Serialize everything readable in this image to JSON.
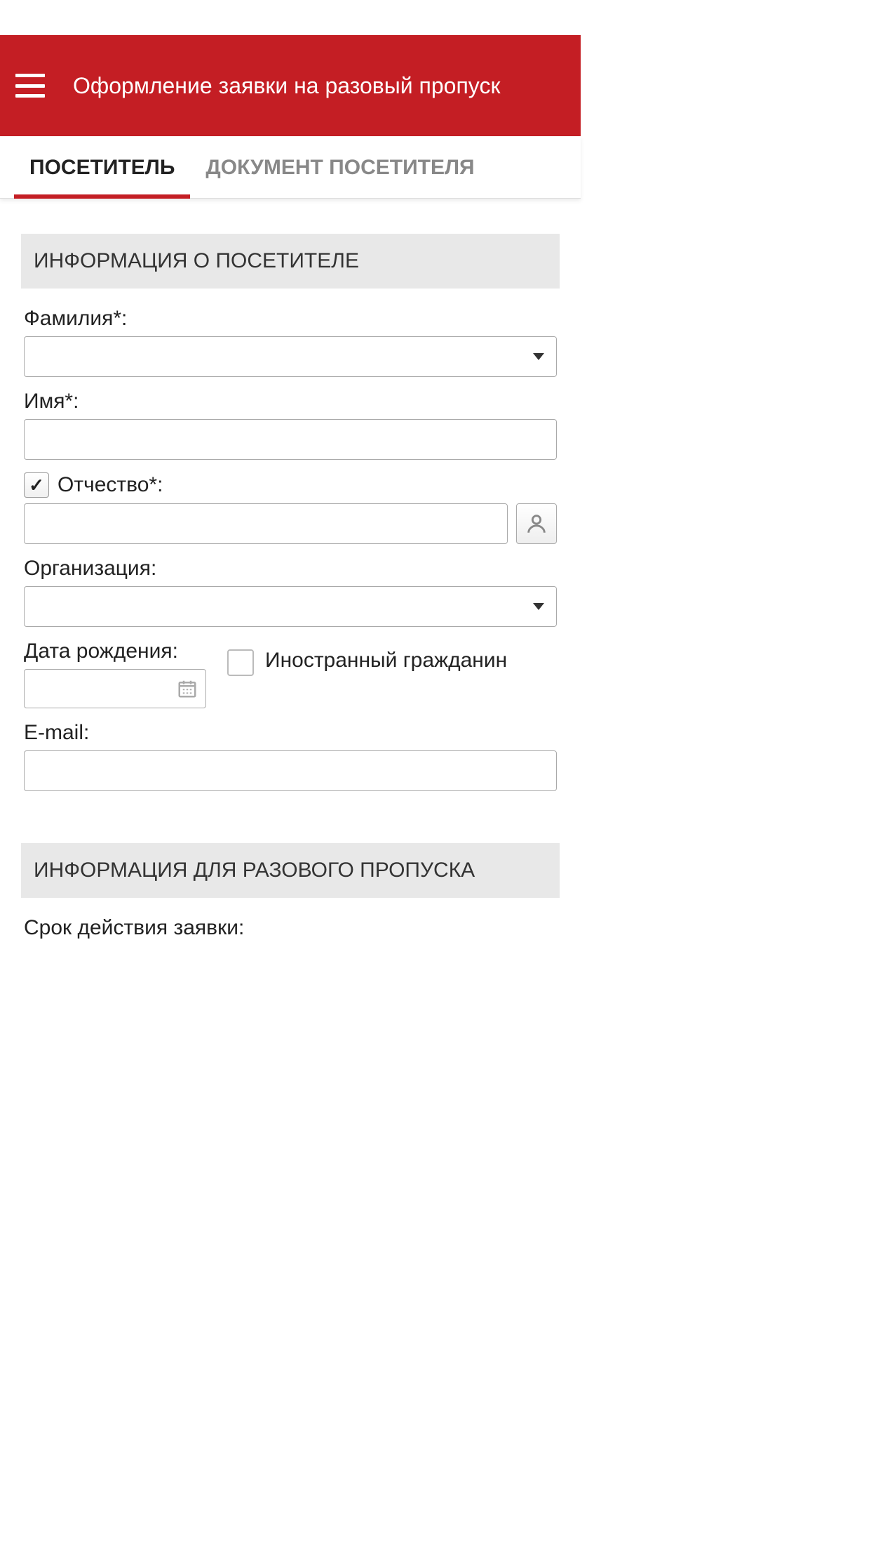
{
  "header": {
    "title": "Оформление заявки на разовый пропуск"
  },
  "tabs": {
    "visitor": "ПОСЕТИТЕЛЬ",
    "document": "ДОКУМЕНТ ПОСЕТИТЕЛЯ"
  },
  "sections": {
    "visitorInfo": "ИНФОРМАЦИЯ О ПОСЕТИТЕЛЕ",
    "passInfo": "ИНФОРМАЦИЯ ДЛЯ РАЗОВОГО ПРОПУСКА"
  },
  "form": {
    "surname": {
      "label": "Фамилия*:",
      "value": ""
    },
    "firstName": {
      "label": "Имя*:",
      "value": ""
    },
    "patronymic": {
      "label": "Отчество*:",
      "value": "",
      "enabled": true
    },
    "organization": {
      "label": "Организация:",
      "value": ""
    },
    "birthDate": {
      "label": "Дата рождения:",
      "value": ""
    },
    "foreignCitizen": {
      "label": "Иностранный гражданин",
      "checked": false
    },
    "email": {
      "label": "E-mail:",
      "value": ""
    },
    "validityPeriod": {
      "label": "Срок действия заявки:"
    }
  }
}
